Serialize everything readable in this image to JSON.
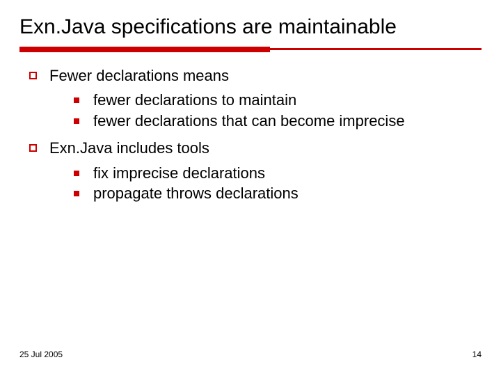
{
  "title": "Exn.Java specifications are maintainable",
  "points": [
    {
      "label": "Fewer declarations means",
      "sub": [
        "fewer declarations to maintain",
        "fewer declarations that can become imprecise"
      ]
    },
    {
      "label": "Exn.Java includes tools",
      "sub": [
        "fix imprecise declarations",
        "propagate throws declarations"
      ]
    }
  ],
  "footer": {
    "date": "25 Jul 2005",
    "page": "14"
  }
}
